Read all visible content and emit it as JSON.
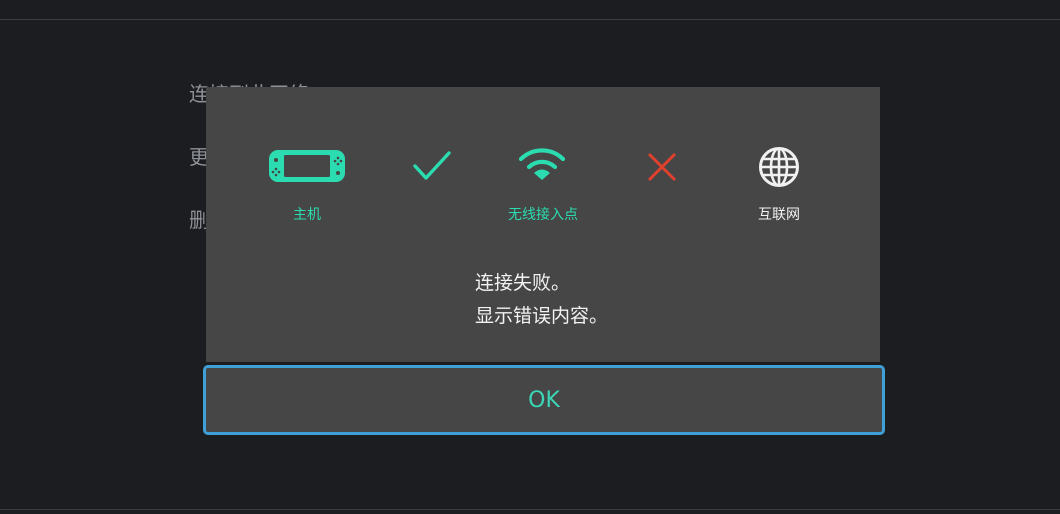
{
  "background_menu": {
    "items": [
      {
        "label": "连接到此网络"
      },
      {
        "label": "更"
      },
      {
        "label": "删"
      }
    ]
  },
  "dialog": {
    "nodes": [
      {
        "icon": "switch-console-icon",
        "label": "主机",
        "color": "#2bdcb0"
      },
      {
        "icon": "checkmark-icon",
        "status": "connected",
        "color": "#2bdcb0"
      },
      {
        "icon": "wifi-icon",
        "label": "无线接入点",
        "color": "#2bdcb0"
      },
      {
        "icon": "cross-icon",
        "status": "failed",
        "color": "#e0412d"
      },
      {
        "icon": "globe-icon",
        "label": "互联网",
        "color": "#f1f1f1"
      }
    ],
    "message_line1": "连接失败。",
    "message_line2": "显示错误内容。",
    "ok_label": "OK"
  },
  "colors": {
    "accent_teal": "#2bdcb0",
    "error_red": "#e0412d",
    "focus_blue": "#3fa0d8",
    "dialog_bg": "#464646",
    "screen_bg": "#1b1d20"
  }
}
